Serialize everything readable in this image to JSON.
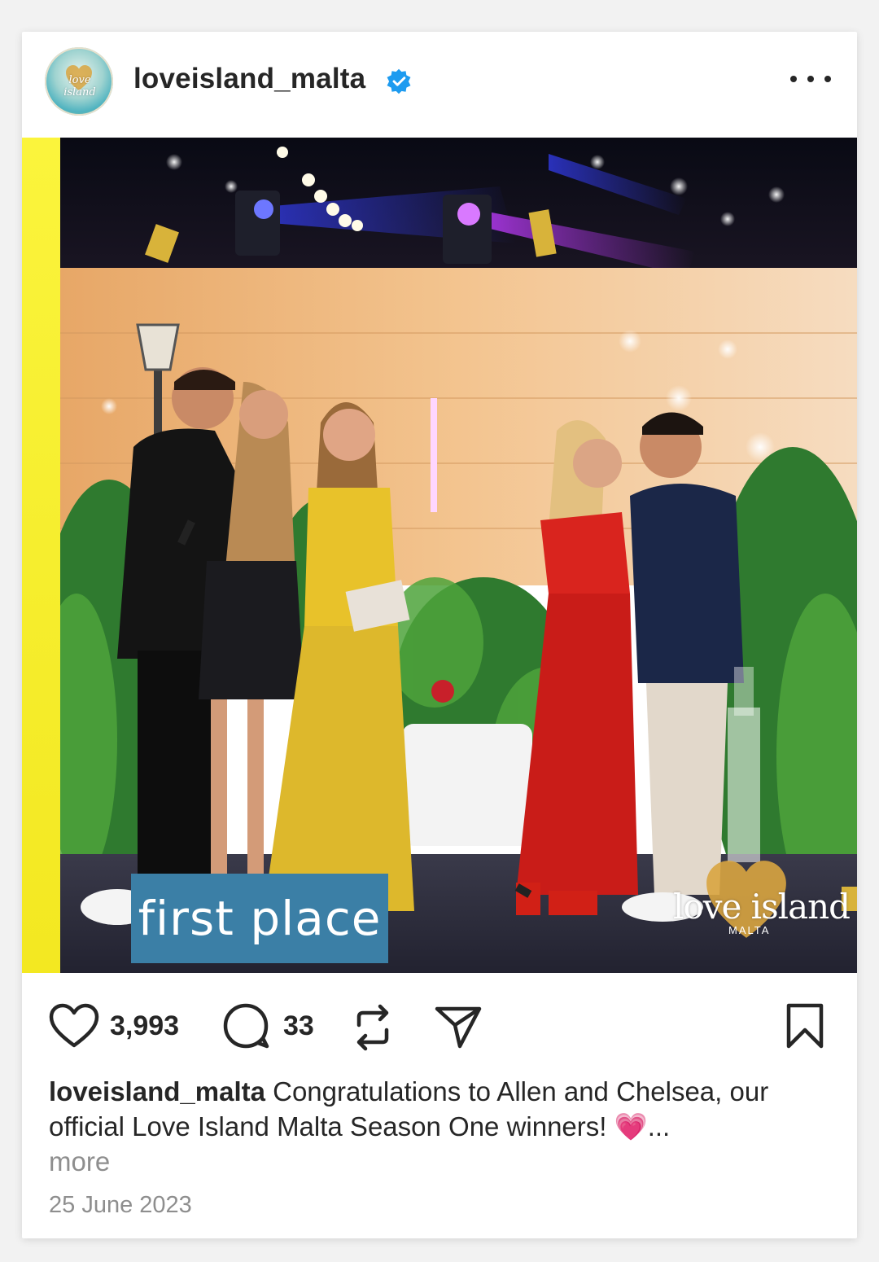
{
  "post": {
    "username": "loveisland_malta",
    "verified": true,
    "avatar_logo_text": "love island",
    "image": {
      "overlay_label": "first place",
      "watermark_main": "love island",
      "watermark_sub": "MALTA"
    },
    "likes": "3,993",
    "comments": "33",
    "caption_user": "loveisland_malta",
    "caption_text": " Congratulations to Allen and Chelsea, our official Love Island Malta Season One winners! 💗...",
    "more_label": "more",
    "date": "25 June 2023"
  },
  "icons": {
    "more": "more-horizontal-icon",
    "like": "heart-icon",
    "comment": "comment-bubble-icon",
    "repost": "repost-icon",
    "share": "send-icon",
    "save": "bookmark-icon",
    "verified": "verified-badge-icon"
  },
  "colors": {
    "verified_blue": "#1d9bf0",
    "label_bg": "#3b7fa6",
    "yellow_strip": "#f6ee2e",
    "text": "#262626",
    "muted": "#8e8e8e"
  }
}
